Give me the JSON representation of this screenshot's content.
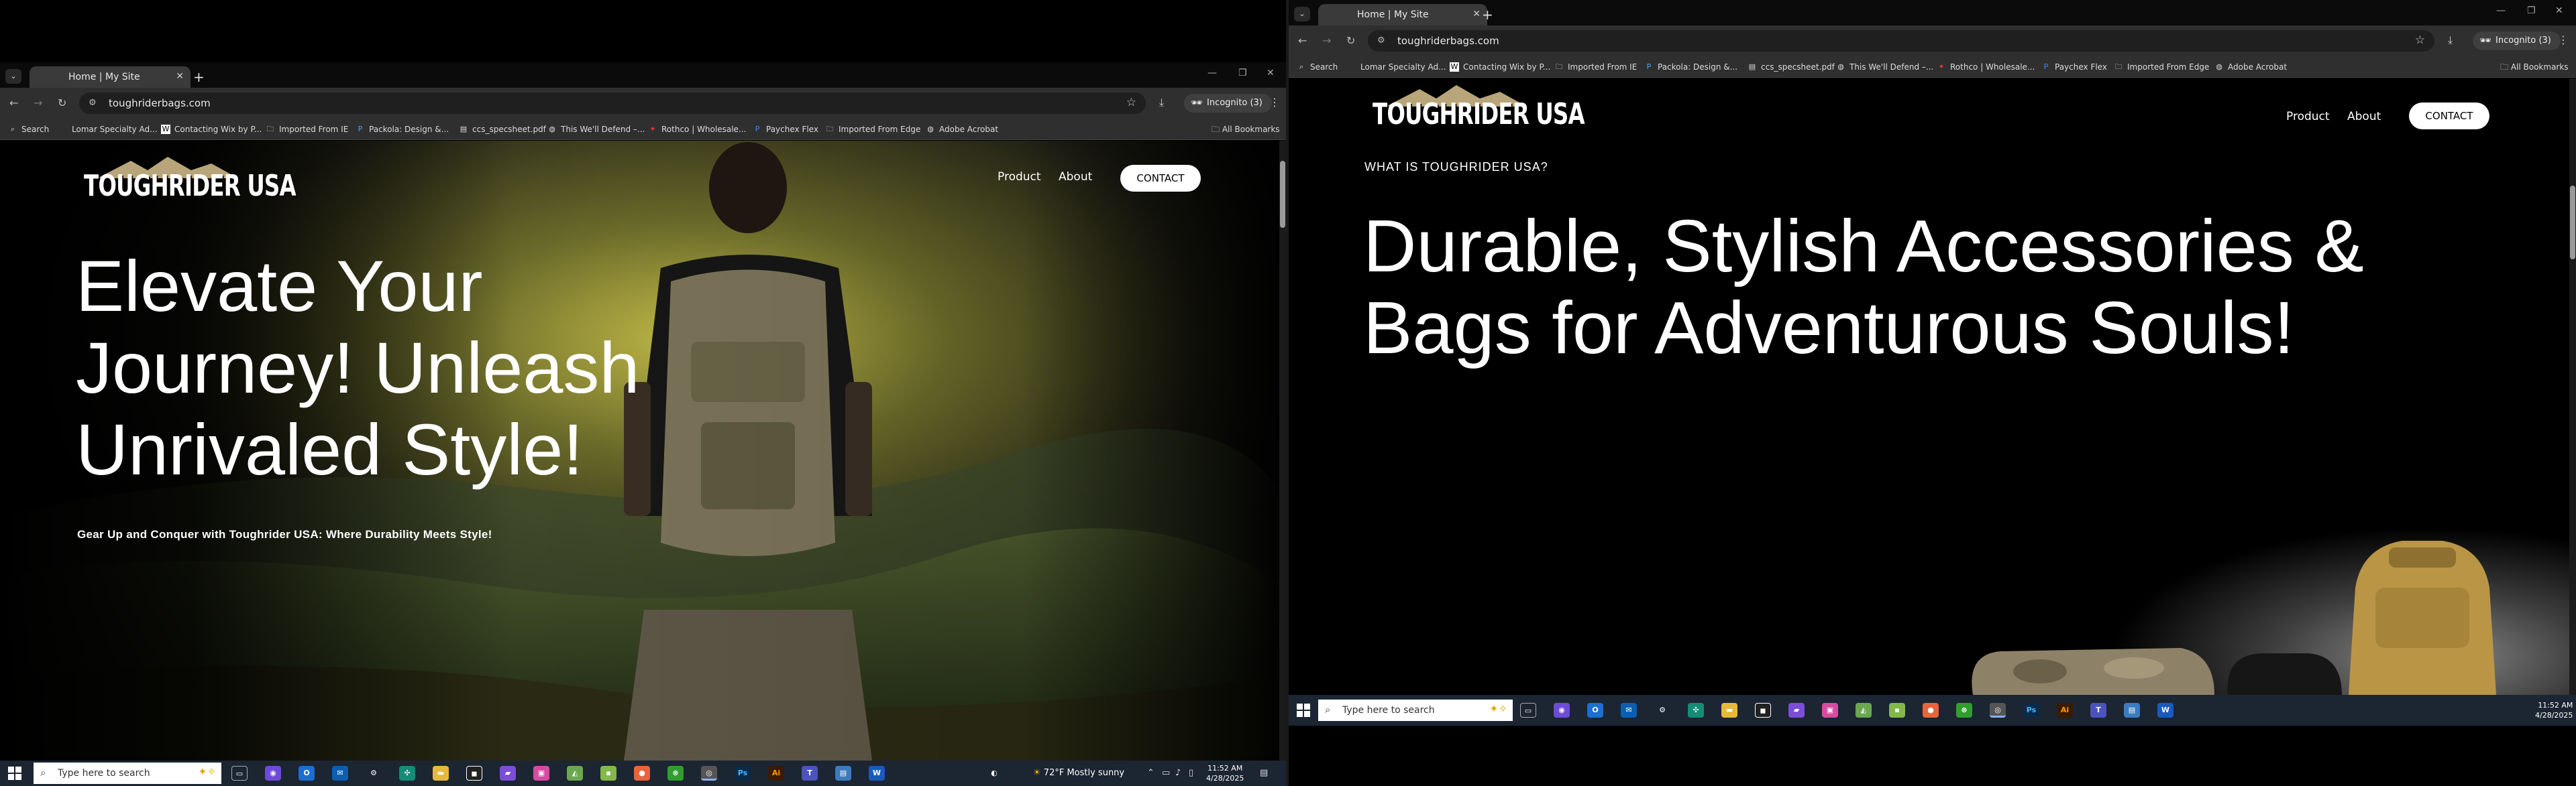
{
  "browser": {
    "tab_title": "Home | My Site",
    "url": "toughriderbags.com",
    "incognito_label": "Incognito (3)",
    "bookmarks": [
      "Search",
      "Lomar Specialty Ad...",
      "Contacting Wix by P...",
      "Imported From IE",
      "Packola: Design &...",
      "ccs_specsheet.pdf",
      "This We'll Defend –...",
      "Rothco | Wholesale...",
      "Paychex Flex",
      "Imported From Edge",
      "Adobe Acrobat"
    ],
    "all_bookmarks": "All Bookmarks"
  },
  "site": {
    "logo_text": "TOUGHRIDER USA",
    "nav": {
      "product": "Product",
      "about": "About",
      "contact": "CONTACT"
    },
    "hero": {
      "title_lines": [
        "Elevate Your",
        "Journey! Unleash",
        "Unrivaled Style!"
      ],
      "subtitle": "Gear Up and Conquer with Toughrider USA: Where Durability Meets Style!"
    },
    "about_section": {
      "eyebrow": "WHAT IS TOUGHRIDER USA?",
      "title_lines": [
        "Durable, Stylish Accessories &",
        "Bags for Adventurous Souls!"
      ]
    }
  },
  "taskbar": {
    "search_placeholder": "Type here to search",
    "weather": "72°F  Mostly sunny",
    "time": "11:52 AM",
    "date": "4/28/2025",
    "icons": [
      "task-view",
      "copilot",
      "outlook",
      "mail",
      "settings",
      "green-app",
      "file-explorer",
      "black-app",
      "purple-app",
      "photos",
      "store",
      "green-square",
      "firefox",
      "xbox",
      "chrome",
      "photoshop",
      "illustrator",
      "teams",
      "notepad",
      "word"
    ]
  },
  "colors": {
    "tab_bg": "#3a3a3a",
    "toolbar_bg": "#2f2f2f",
    "taskbar_bg": "#1c2532",
    "contact_button_bg": "#ffffff"
  }
}
